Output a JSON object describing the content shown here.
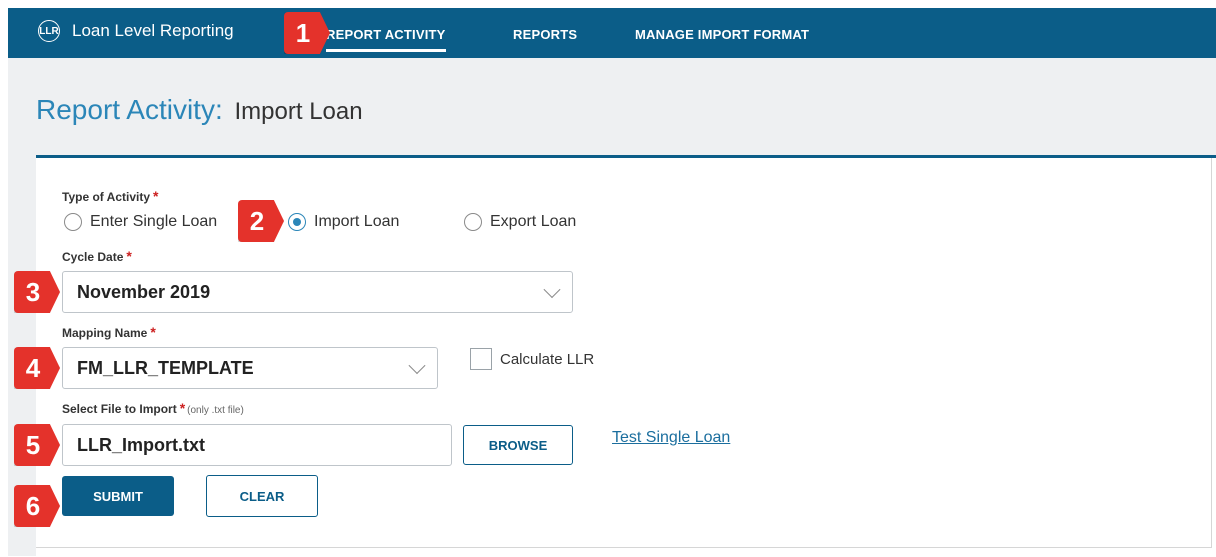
{
  "app": {
    "title": "Loan Level Reporting",
    "logo_text": "LLR"
  },
  "nav": {
    "items": [
      {
        "label": "REPORT ACTIVITY",
        "active": true
      },
      {
        "label": "REPORTS",
        "active": false
      },
      {
        "label": "MANAGE IMPORT FORMAT",
        "active": false
      }
    ]
  },
  "page": {
    "title": "Report Activity:",
    "subtitle": "Import Loan"
  },
  "form": {
    "type_of_activity": {
      "label": "Type of Activity",
      "required_mark": "*",
      "options": [
        {
          "label": "Enter Single Loan",
          "checked": false
        },
        {
          "label": "Import Loan",
          "checked": true
        },
        {
          "label": "Export Loan",
          "checked": false
        }
      ]
    },
    "cycle_date": {
      "label": "Cycle Date",
      "required_mark": "*",
      "value": "November 2019"
    },
    "mapping_name": {
      "label": "Mapping Name",
      "required_mark": "*",
      "value": "FM_LLR_TEMPLATE"
    },
    "calculate_llr": {
      "label": "Calculate LLR",
      "checked": false
    },
    "select_file": {
      "label": "Select File to Import",
      "required_mark": "*",
      "hint": "(only .txt file)",
      "value": "LLR_Import.txt",
      "browse_label": "BROWSE"
    },
    "test_single_loan_link": "Test Single Loan",
    "submit_label": "SUBMIT",
    "clear_label": "CLEAR"
  },
  "callouts": [
    "1",
    "2",
    "3",
    "4",
    "5",
    "6"
  ],
  "colors": {
    "nav_bg": "#0b5d88",
    "title_blue": "#2b86b8",
    "badge_red": "#e4322b",
    "required_red": "#cc1f1f"
  }
}
